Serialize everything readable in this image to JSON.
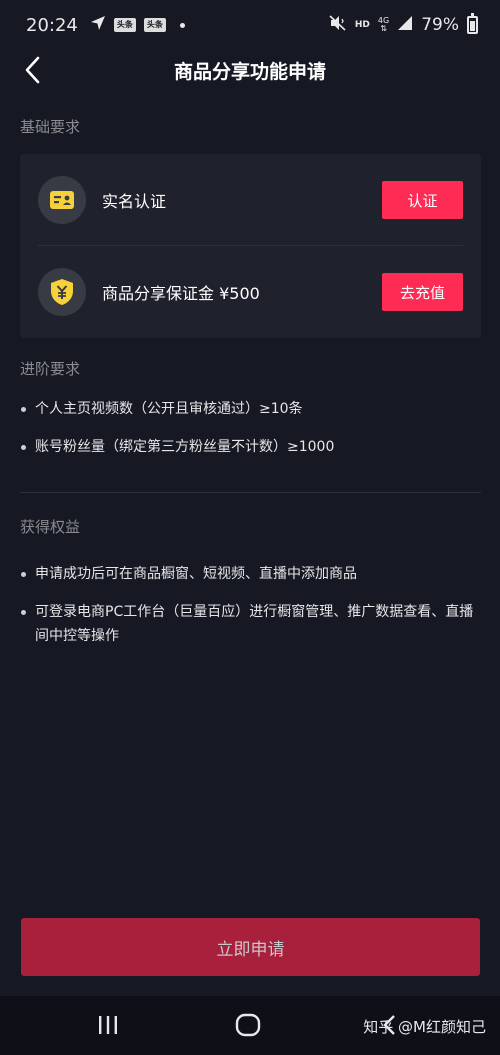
{
  "status_bar": {
    "time": "20:24",
    "badge1": "头条",
    "badge2": "头条",
    "network_hd": "HD",
    "network_4g": "4G",
    "battery": "79%"
  },
  "header": {
    "title": "商品分享功能申请"
  },
  "basic": {
    "section_title": "基础要求",
    "items": [
      {
        "label": "实名认证",
        "button": "认证",
        "icon": "id-card-icon"
      },
      {
        "label": "商品分享保证金 ¥500",
        "button": "去充值",
        "icon": "yuan-shield-icon"
      }
    ]
  },
  "advanced": {
    "section_title": "进阶要求",
    "items": [
      "个人主页视频数（公开且审核通过）≥10条",
      "账号粉丝量（绑定第三方粉丝量不计数）≥1000"
    ]
  },
  "benefits": {
    "section_title": "获得权益",
    "items": [
      "申请成功后可在商品橱窗、短视频、直播中添加商品",
      "可登录电商PC工作台（巨量百应）进行橱窗管理、推广数据查看、直播间中控等操作"
    ]
  },
  "apply_button": "立即申请",
  "watermark": "知乎 @M红颜知己",
  "colors": {
    "background": "#161823",
    "card": "#1f212c",
    "accent": "#fe2c55",
    "icon_yellow": "#f7d139"
  }
}
